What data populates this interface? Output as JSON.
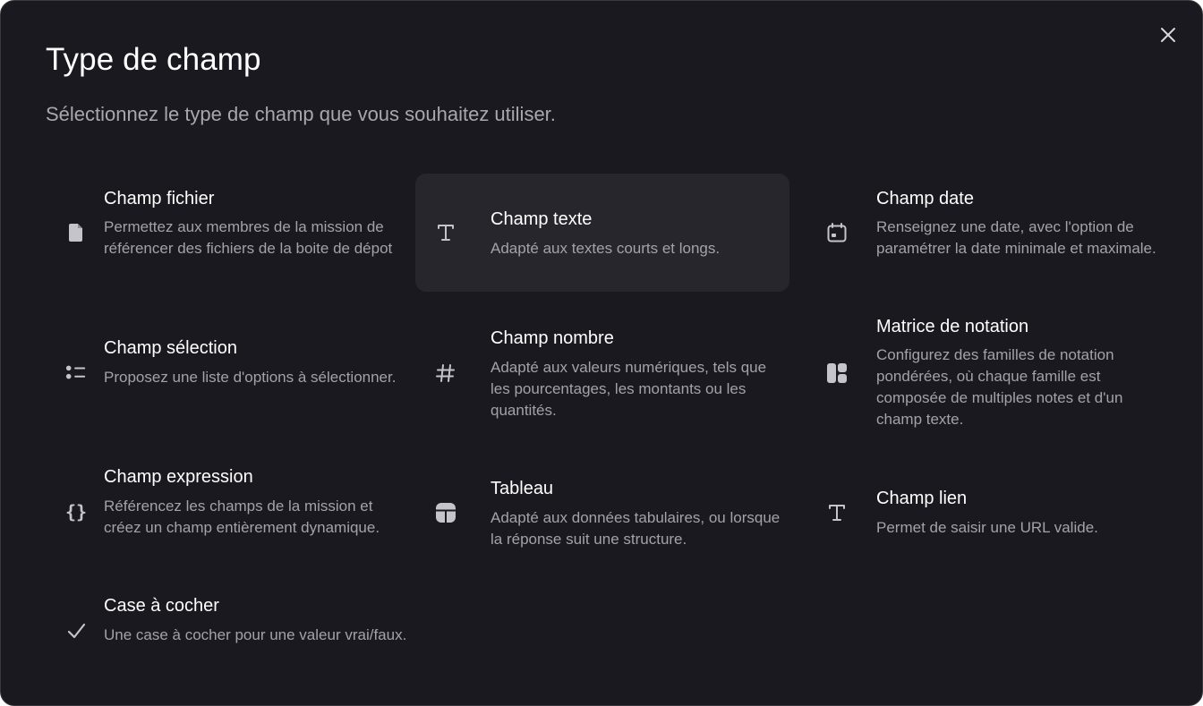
{
  "dialog": {
    "title": "Type de champ",
    "subtitle": "Sélectionnez le type de champ que vous souhaitez utiliser.",
    "close_icon": "close-icon"
  },
  "options": [
    {
      "title": "Champ fichier",
      "description": "Permettez aux membres de la mission de référencer des fichiers de la boite de dépot",
      "icon": "file-icon"
    },
    {
      "title": "Champ texte",
      "description": "Adapté aux textes courts et longs.",
      "icon": "text-icon",
      "highlighted": true
    },
    {
      "title": "Champ date",
      "description": "Renseignez une date, avec l'option de paramétrer la date minimale et maximale.",
      "icon": "calendar-icon"
    },
    {
      "title": "Champ sélection",
      "description": "Proposez une liste d'options à sélectionner.",
      "icon": "list-icon"
    },
    {
      "title": "Champ nombre",
      "description": "Adapté aux valeurs numériques, tels que les pourcentages, les montants ou les quantités.",
      "icon": "hash-icon"
    },
    {
      "title": "Matrice de notation",
      "description": "Configurez des familles de notation pondérées, où chaque famille est composée de multiples notes et d'un champ texte.",
      "icon": "layout-grid-icon"
    },
    {
      "title": "Champ expression",
      "description": "Référencez les champs de la mission et créez un champ entièrement dynamique.",
      "icon": "braces-icon"
    },
    {
      "title": "Tableau",
      "description": "Adapté aux données tabulaires, ou lorsque la réponse suit une structure.",
      "icon": "table-icon"
    },
    {
      "title": "Champ lien",
      "description": "Permet de saisir une URL valide.",
      "icon": "text-icon"
    },
    {
      "title": "Case à cocher",
      "description": "Une case à cocher pour une valeur vrai/faux.",
      "icon": "check-icon"
    }
  ],
  "colors": {
    "background": "#1a191f",
    "highlight": "#27262c",
    "title": "#ffffff",
    "description": "#a3a2a8",
    "icon": "#c5c4ca"
  }
}
